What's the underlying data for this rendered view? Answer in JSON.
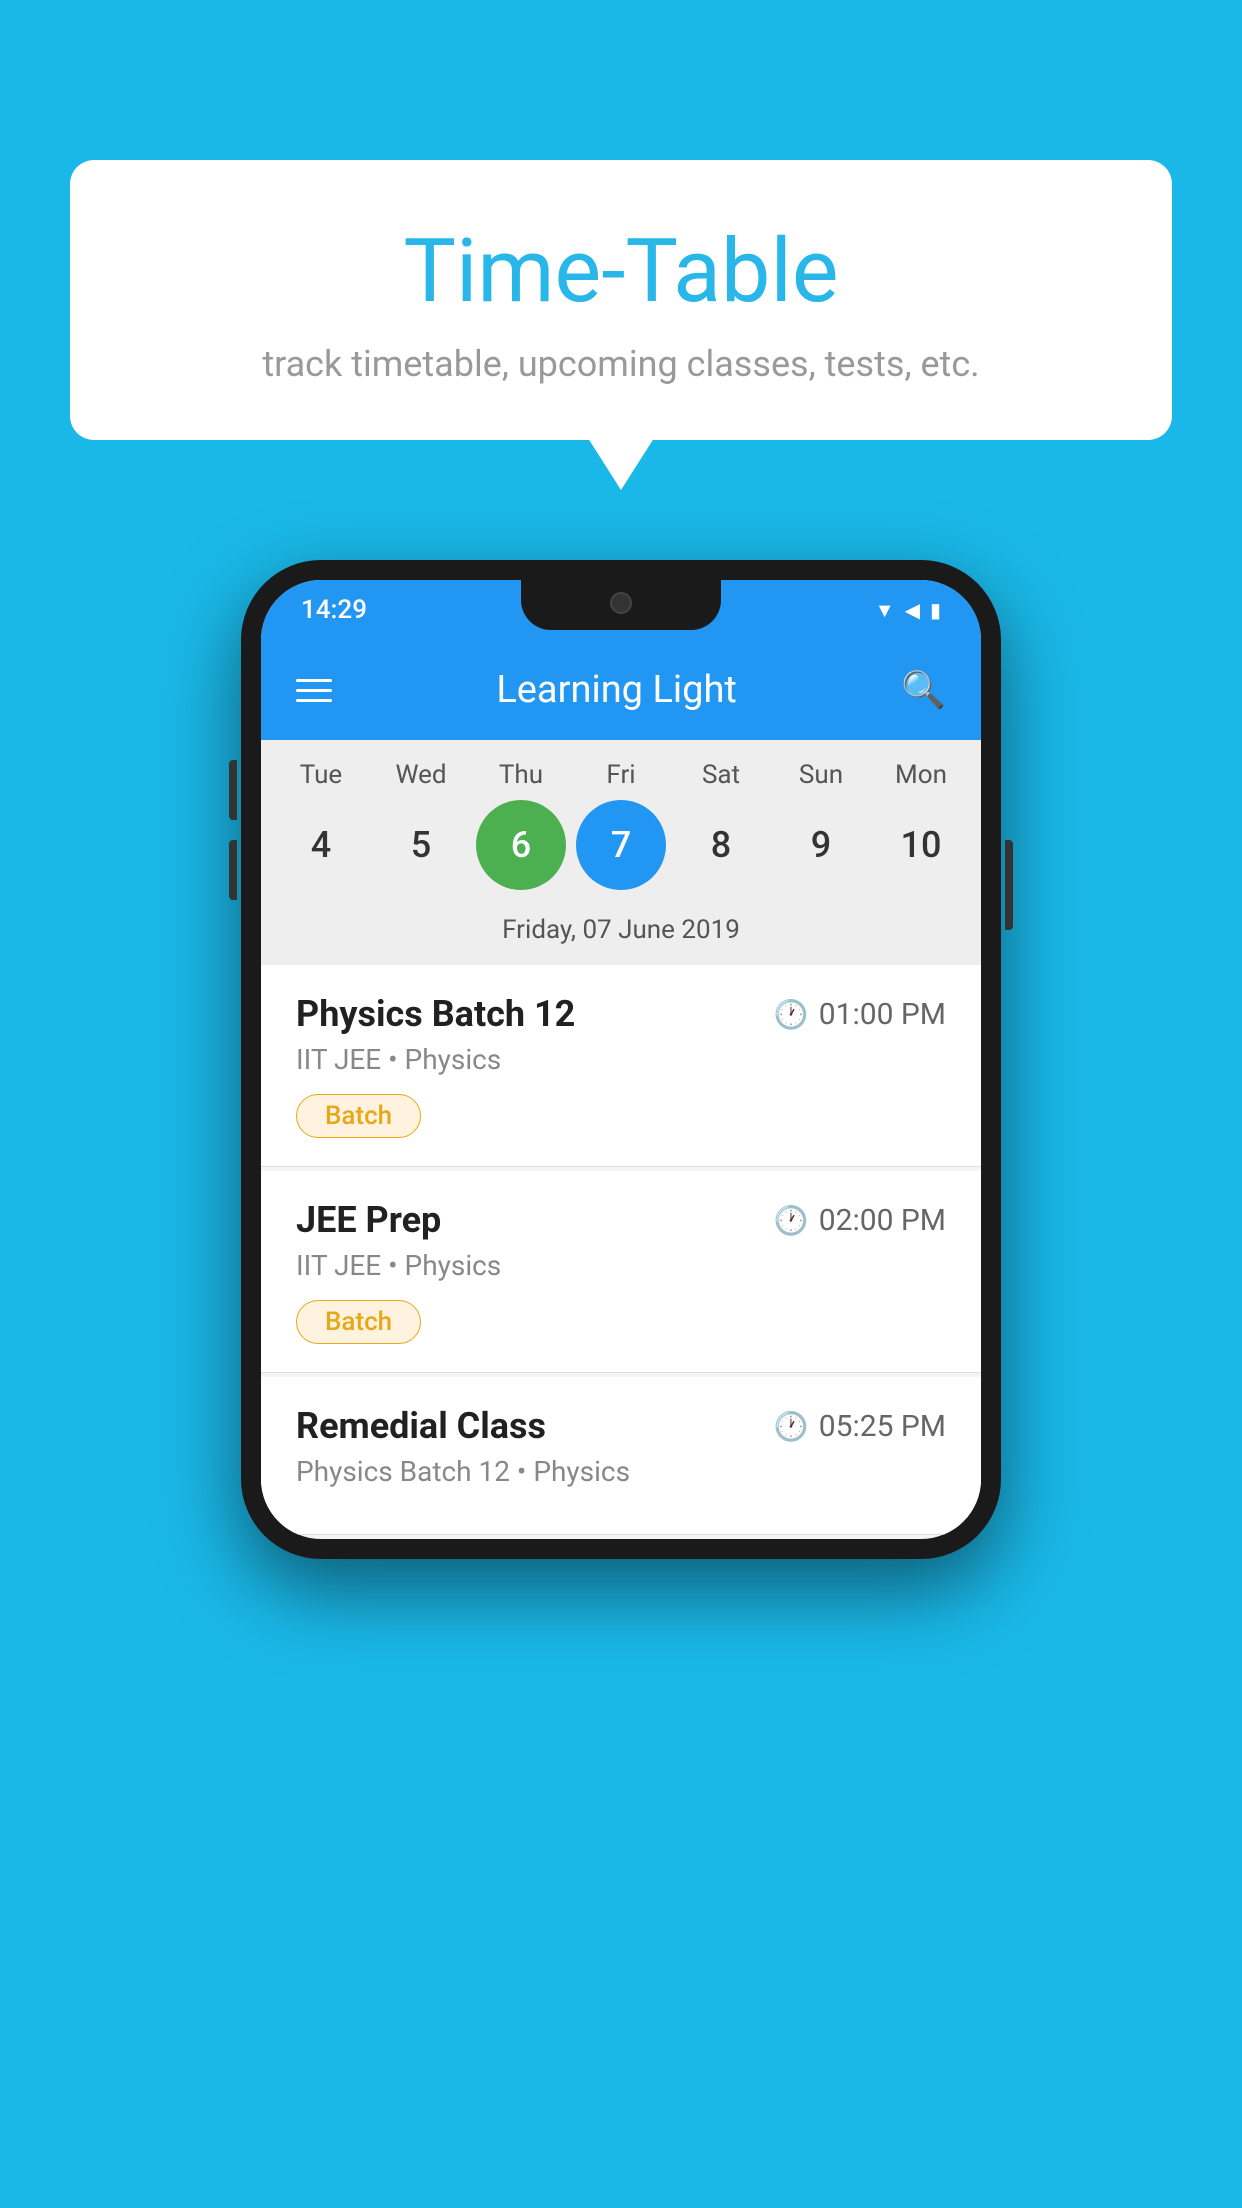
{
  "background_color": "#1ab8e8",
  "card": {
    "title": "Time-Table",
    "subtitle": "track timetable, upcoming classes, tests, etc."
  },
  "phone": {
    "status_bar": {
      "time": "14:29"
    },
    "app_bar": {
      "title": "Learning Light"
    },
    "calendar": {
      "days": [
        {
          "name": "Tue",
          "number": "4",
          "state": "normal"
        },
        {
          "name": "Wed",
          "number": "5",
          "state": "normal"
        },
        {
          "name": "Thu",
          "number": "6",
          "state": "today"
        },
        {
          "name": "Fri",
          "number": "7",
          "state": "selected"
        },
        {
          "name": "Sat",
          "number": "8",
          "state": "normal"
        },
        {
          "name": "Sun",
          "number": "9",
          "state": "normal"
        },
        {
          "name": "Mon",
          "number": "10",
          "state": "normal"
        }
      ],
      "selected_date": "Friday, 07 June 2019"
    },
    "events": [
      {
        "title": "Physics Batch 12",
        "time": "01:00 PM",
        "subtitle": "IIT JEE • Physics",
        "tag": "Batch"
      },
      {
        "title": "JEE Prep",
        "time": "02:00 PM",
        "subtitle": "IIT JEE • Physics",
        "tag": "Batch"
      },
      {
        "title": "Remedial Class",
        "time": "05:25 PM",
        "subtitle": "Physics Batch 12 • Physics",
        "tag": ""
      }
    ]
  }
}
